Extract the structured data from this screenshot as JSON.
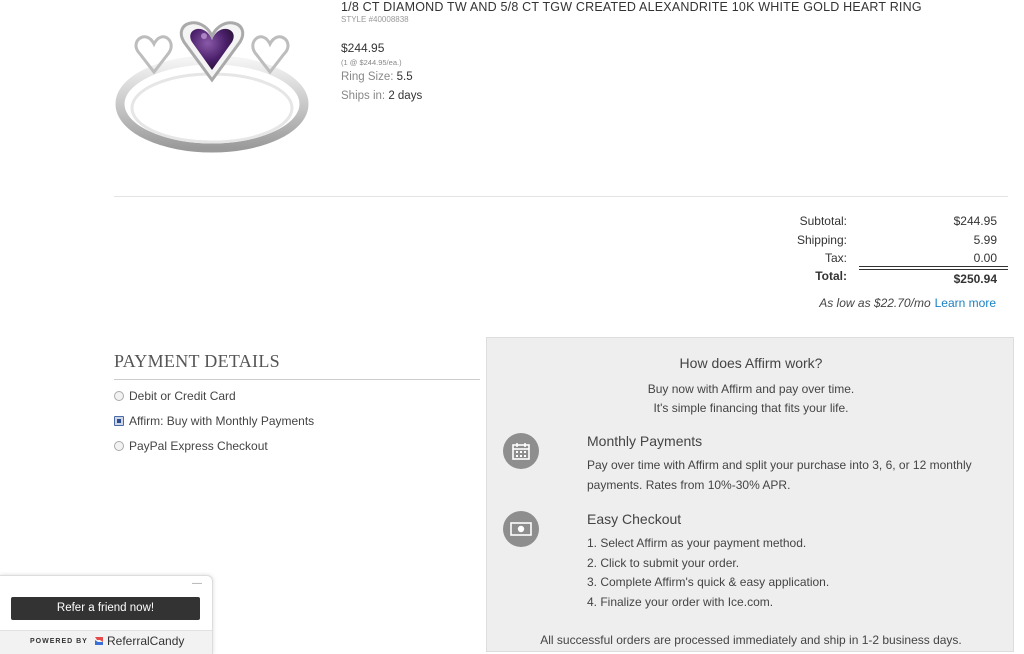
{
  "product": {
    "title": "1/8 CT DIAMOND TW AND 5/8 CT TGW CREATED ALEXANDRITE 10K WHITE GOLD HEART RING",
    "style": "STYLE #40008838",
    "price": "$244.95",
    "unit_price": "(1 @ $244.95/ea.)",
    "ring_size_label": "Ring Size:",
    "ring_size_value": "5.5",
    "ships_label": "Ships in:",
    "ships_value": "2 days"
  },
  "totals": {
    "subtotal_label": "Subtotal:",
    "subtotal": "$244.95",
    "shipping_label": "Shipping:",
    "shipping": "5.99",
    "tax_label": "Tax:",
    "tax": "0.00",
    "total_label": "Total:",
    "total": "$250.94",
    "as_low_as": "As low as $22.70/mo",
    "learn_more": "Learn more"
  },
  "payment": {
    "title": "PAYMENT DETAILS",
    "options": [
      {
        "label": "Debit or Credit Card",
        "selected": false
      },
      {
        "label": "Affirm: Buy with Monthly Payments",
        "selected": true
      },
      {
        "label": "PayPal Express Checkout",
        "selected": false
      }
    ]
  },
  "affirm": {
    "title": "How does Affirm work?",
    "subtitle_1": "Buy now with Affirm and pay over time.",
    "subtitle_2": "It's simple financing that fits your life.",
    "monthly_heading": "Monthly Payments",
    "monthly_text": "Pay over time with Affirm and split your purchase into 3, 6, or 12 monthly payments. Rates from 10%-30% APR.",
    "easy_heading": "Easy Checkout",
    "steps": [
      "1. Select Affirm as your payment method.",
      "2. Click to submit your order.",
      "3. Complete Affirm's quick & easy application.",
      "4. Finalize your order with Ice.com."
    ],
    "footer": "All successful orders are processed immediately and ship in 1-2 business days."
  },
  "referral": {
    "minimize": "—",
    "button": "Refer a friend now!",
    "powered_by": "POWERED BY",
    "brand": "ReferralCandy"
  },
  "colors": {
    "link": "#1a82c2",
    "panel_bg": "#eeeeee",
    "icon_circle": "#8e8e8e"
  }
}
